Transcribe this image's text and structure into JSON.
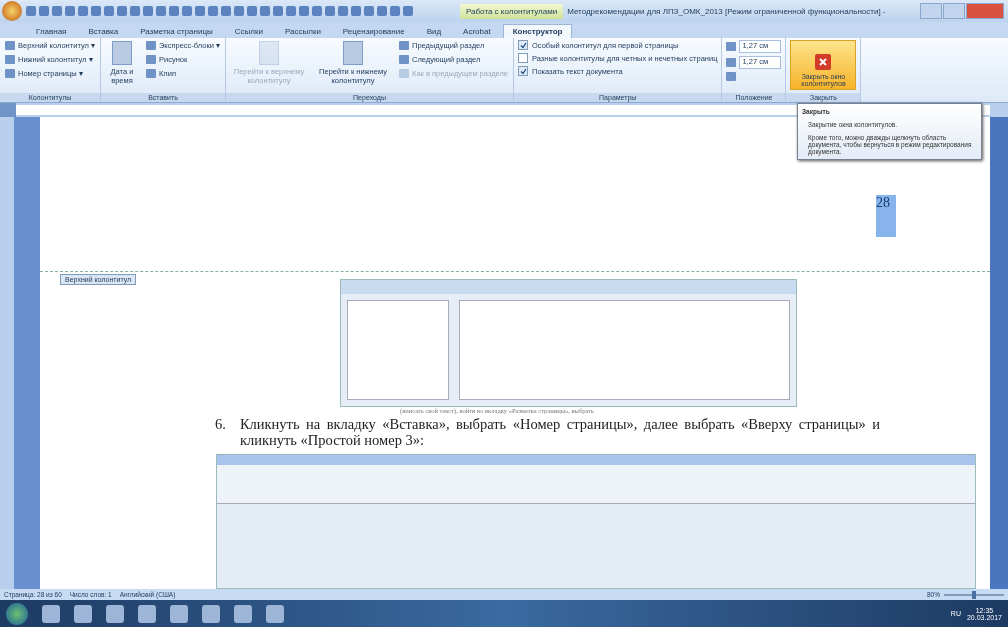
{
  "window": {
    "context": "Работа с колонтитулами",
    "title": "Методрекомендации для ЛПЗ_ОМК_2013 [Режим ограниченной функциональности] -"
  },
  "tabs": [
    {
      "label": "Главная",
      "selected": false,
      "kind": "normal"
    },
    {
      "label": "Вставка",
      "selected": false,
      "kind": "normal"
    },
    {
      "label": "Разметка страницы",
      "selected": false,
      "kind": "normal"
    },
    {
      "label": "Ссылки",
      "selected": false,
      "kind": "normal"
    },
    {
      "label": "Рассылки",
      "selected": false,
      "kind": "normal"
    },
    {
      "label": "Рецензирование",
      "selected": false,
      "kind": "normal"
    },
    {
      "label": "Вид",
      "selected": false,
      "kind": "normal"
    },
    {
      "label": "Acrobat",
      "selected": false,
      "kind": "normal"
    },
    {
      "label": "Конструктор",
      "selected": true,
      "kind": "contextual"
    }
  ],
  "ribbon": [
    {
      "label": "Колонтитулы",
      "columns": [
        [
          {
            "kind": "small",
            "label": "Верхний колонтитул ▾",
            "disabled": false
          },
          {
            "kind": "small",
            "label": "Нижний колонтитул ▾",
            "disabled": false
          },
          {
            "kind": "small",
            "label": "Номер страницы ▾",
            "disabled": false
          }
        ]
      ]
    },
    {
      "label": "Вставить",
      "columns": [
        [
          {
            "kind": "large",
            "label": "Дата и время",
            "disabled": false
          }
        ],
        [
          {
            "kind": "small",
            "label": "Экспресс-блоки ▾",
            "disabled": false
          },
          {
            "kind": "small",
            "label": "Рисунок",
            "disabled": false
          },
          {
            "kind": "small",
            "label": "Клип",
            "disabled": false
          }
        ]
      ]
    },
    {
      "label": "Переходы",
      "columns": [
        [
          {
            "kind": "large",
            "label": "Перейти к верхнему колонтитулу",
            "disabled": true
          }
        ],
        [
          {
            "kind": "large",
            "label": "Перейти к нижнему колонтитулу",
            "disabled": false
          }
        ],
        [
          {
            "kind": "small",
            "label": "Предыдущий раздел",
            "disabled": false
          },
          {
            "kind": "small",
            "label": "Следующий раздел",
            "disabled": false
          },
          {
            "kind": "small",
            "label": "Как в предыдущем разделе",
            "disabled": true
          }
        ]
      ]
    },
    {
      "label": "Параметры",
      "columns": [
        [
          {
            "kind": "check",
            "label": "Особый колонтитул для первой страницы",
            "checked": true
          },
          {
            "kind": "check",
            "label": "Разные колонтитулы для четных и нечетных страниц",
            "checked": false
          },
          {
            "kind": "check",
            "label": "Показать текст документа",
            "checked": true
          }
        ]
      ]
    },
    {
      "label": "Положение",
      "columns": [
        [
          {
            "kind": "spin",
            "label": "1,27 см"
          },
          {
            "kind": "spin",
            "label": "1,27 см"
          },
          {
            "kind": "align"
          }
        ]
      ]
    },
    {
      "label": "Закрыть",
      "columns": [
        [
          {
            "kind": "close",
            "label": "Закрыть окно колонтитулов"
          }
        ]
      ]
    }
  ],
  "tooltip": {
    "title": "Закрыть",
    "lines": [
      "Закрытие окна колонтитулов.",
      "Кроме того, можно дважды щелкнуть область документа, чтобы вернуться в режим редактирования документа."
    ]
  },
  "document": {
    "page_number": "28",
    "header_tag": "Верхний колонтитул",
    "caption": "(вписать свой текст), войти во вкладку «Разметка страницы», выбрать",
    "paragraph": {
      "number": "6.",
      "text": "Кликнуть на вкладку «Вставка», выбрать «Номер страницы», далее выбрать «Вверху страницы» и кликнуть «Простой номер 3»:"
    }
  },
  "status_bar": {
    "items": [
      "Страница: 28 из 60",
      "Число слов: 1",
      "Английский (США)"
    ],
    "zoom": "80%",
    "level": 0.5
  },
  "taskbar": {
    "language": "RU",
    "time": "12:35",
    "date": "20.03.2017"
  }
}
